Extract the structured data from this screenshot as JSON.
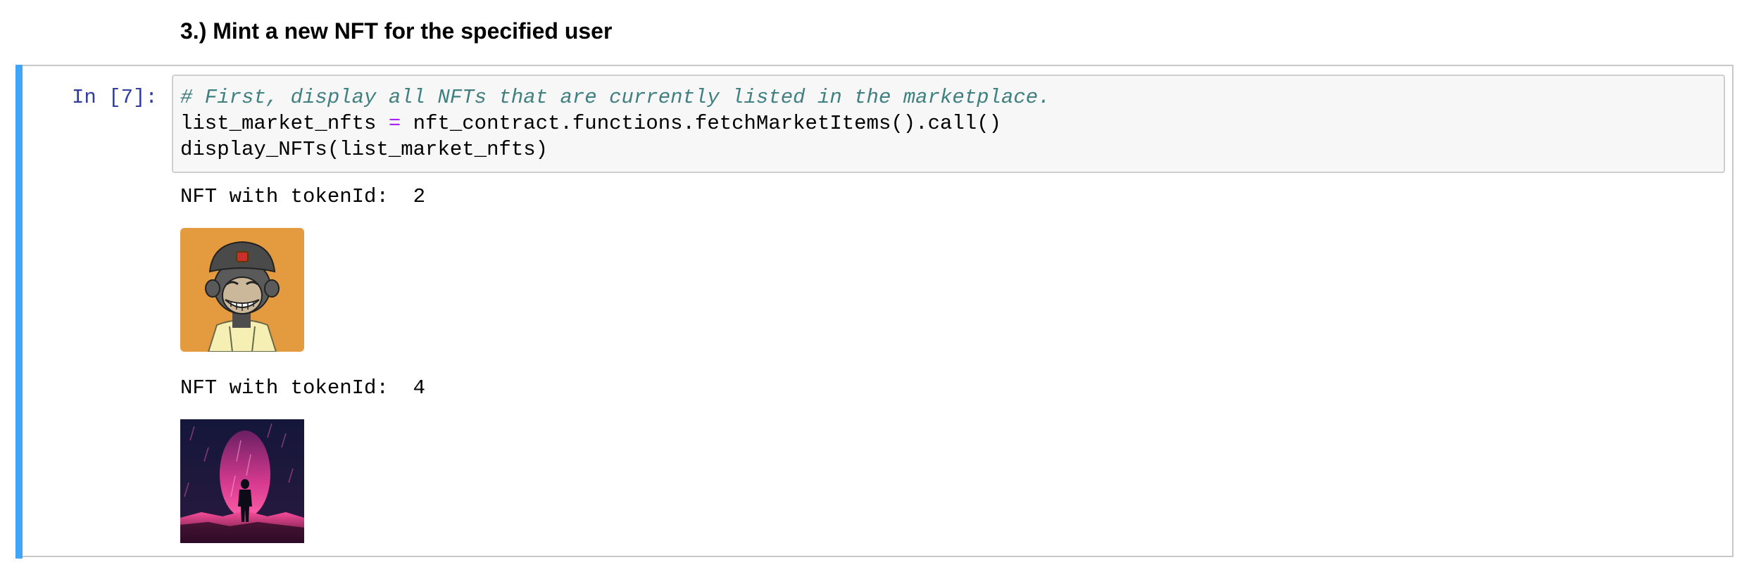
{
  "markdown": {
    "heading": "3.) Mint a new NFT for the specified user"
  },
  "cell": {
    "prompt": "In [7]:",
    "code": {
      "line1_comment": "# First, display all NFTs that are currently listed in the marketplace.",
      "line2_var": "list_market_nfts ",
      "line2_op": "=",
      "line2_rest": " nft_contract.functions.fetchMarketItems().call()",
      "line3": "display_NFTs(list_market_nfts)"
    },
    "output": {
      "items": [
        {
          "label": "NFT with tokenId:  2",
          "image_icon": "bored-ape-nft-image"
        },
        {
          "label": "NFT with tokenId:  4",
          "image_icon": "neon-portal-nft-image"
        }
      ]
    }
  },
  "colors": {
    "cell_bar": "#42a5f5",
    "prompt": "#303f9f",
    "comment": "#408080",
    "operator": "#aa22ff",
    "code_bg": "#f7f7f7"
  }
}
